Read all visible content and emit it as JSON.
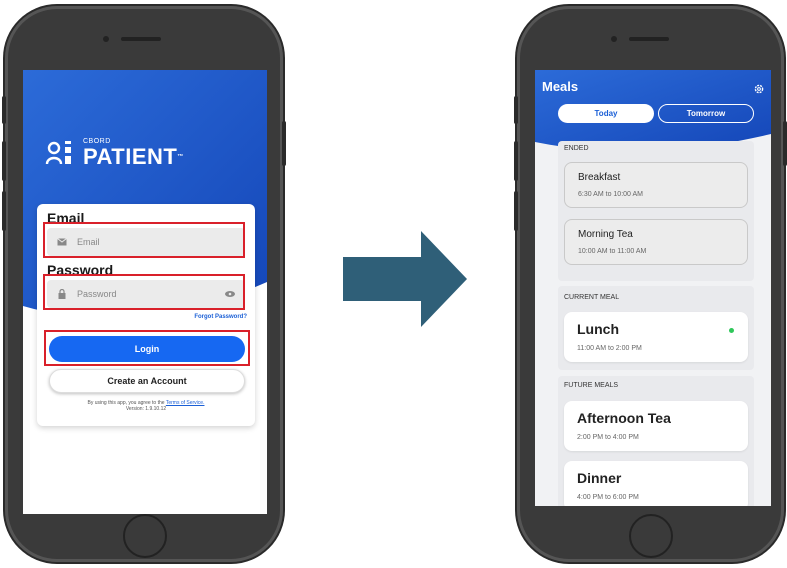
{
  "login": {
    "brand_small": "CBORD",
    "brand_main": "PATIENT",
    "brand_tm": "™",
    "email_label": "Email",
    "email_placeholder": "Email",
    "password_label": "Password",
    "password_placeholder": "Password",
    "forgot": "Forgot Password?",
    "login_button": "Login",
    "create_button": "Create an Account",
    "terms_prefix": "By using this app, you agree to the",
    "terms_link": "Terms of Service.",
    "version": "Version: 1.9.10.12"
  },
  "meals": {
    "title": "Meals",
    "tabs": {
      "today": "Today",
      "tomorrow": "Tomorrow"
    },
    "ended_header": "ENDED",
    "ended": [
      {
        "name": "Breakfast",
        "time": "6:30 AM to 10:00 AM"
      },
      {
        "name": "Morning Tea",
        "time": "10:00 AM to 11:00 AM"
      }
    ],
    "current_header": "CURRENT MEAL",
    "current": {
      "name": "Lunch",
      "time": "11:00 AM to 2:00 PM"
    },
    "future_header": "FUTURE MEALS",
    "future": [
      {
        "name": "Afternoon Tea",
        "time": "2:00 PM to 4:00 PM"
      },
      {
        "name": "Dinner",
        "time": "4:00 PM to 6:00 PM"
      }
    ]
  },
  "colors": {
    "brand_blue": "#1668f2",
    "highlight_red": "#d9202a",
    "arrow": "#2f5f78",
    "current_dot": "#2fc75a"
  },
  "icons": [
    "envelope-icon",
    "lock-icon",
    "eye-icon",
    "gear-icon",
    "cbord-logo-icon",
    "arrow-right-icon"
  ]
}
